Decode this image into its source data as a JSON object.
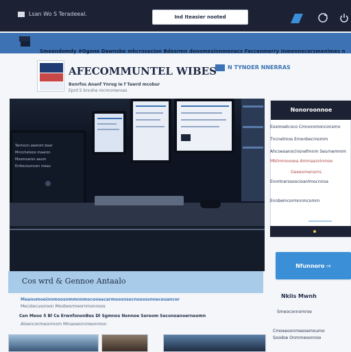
{
  "topbar": {
    "left_text": "Lsan Wo S Teradeeal.",
    "search_value": "Ind Iteasier nooted",
    "icons": [
      "send-icon",
      "refresh-icon",
      "power-icon"
    ]
  },
  "navbar": {
    "ticker": "Smeendomdy  #Ogone Dawnsbe mhcrosecion  Bdesrmn donomesinnmenacs  Faccenmerry  Inmennecarsmenimes n Bo"
  },
  "branding": {
    "site_title": "AFECOMMUNTEL WIBES",
    "tagline": "Bonrfos  Ananf Ynrog  Ie  f  Tawrd mcobur",
    "tagline2": "Eprd  S  bnrohe  mcmnmeroas",
    "right_label": "N  TYNOER NNERRAS"
  },
  "hero": {
    "caption": "Cos wrd & Gennoe Antaalo",
    "screen_left_lines": [
      "Tarmocn  aeerom  baar",
      "Mnncheteoo  maaron",
      "Moomoaron  aeum",
      "Enttecoumcen meau"
    ]
  },
  "sidebar": {
    "header": "Nonoroonnoe",
    "lines": [
      "Eosmoetcoco  Cmnoromonconsmo",
      "Tncnetmos  Emonbecmomm",
      "Ahcoeoanocinsnefmnm  Seurnemmm",
      "Mbtmmoooea  Ammaaroinmoe",
      "Geeeomensms",
      "Enmtnerssoocioanlmocnnoa",
      "Ennbemcormnnmcomrn"
    ],
    "cta_label": "Nfunnoro  ⇨"
  },
  "main": {
    "paragraph1": "Meanomoeinnmoosnmmnnmocooeacarmoosnsocnosossnneceuancer",
    "paragraph2": "Mecstecusoroon  Moobeormeornmonnoos",
    "paragraph3": "Cen  Meoo  5  Bl  Ce  ErwnfononBes  Dl  Sgmnos  Nennoe  Sereom  Seconoanoerneomn",
    "paragraph4": "Aloenconmeonmom  Mmaoeonnmeonmon"
  },
  "right_col": {
    "title": "Nkiis  Mwnh",
    "lines": [
      "Smeoconnomroe",
      "Cmoeeoonmeeoemoumo",
      "Soodoe  Onmmeoonnoo"
    ]
  }
}
